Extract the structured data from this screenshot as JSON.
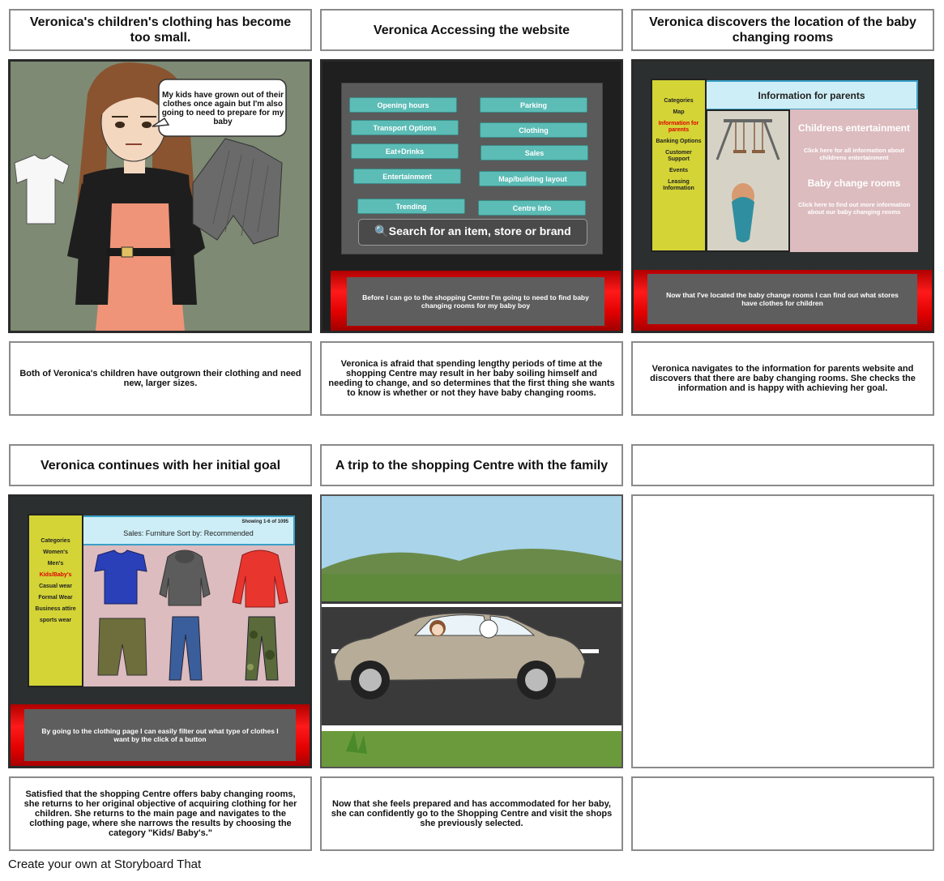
{
  "cells": [
    {
      "title": "Veronica's children's clothing has become too small.",
      "description": "Both of Veronica's children have outgrown their clothing and need new, larger sizes.",
      "speech": "My kids have grown out of their clothes once again but I'm also going to need to prepare for my baby"
    },
    {
      "title": "Veronica Accessing the website",
      "description": "Veronica is afraid that spending lengthy periods of time at the shopping Centre may result in her baby soiling himself and needing to change, and so determines that the first thing she wants to know is whether or not they have baby changing rooms.",
      "menu_left": [
        "Opening hours",
        "Transport Options",
        "Eat+Drinks",
        "Entertainment",
        "Trending"
      ],
      "menu_right": [
        "Parking",
        "Clothing",
        "Sales",
        "Map/building layout",
        "Centre Info"
      ],
      "search_label": "Search for an item, store or brand",
      "caption": "Before I can go to the shopping Centre I'm going to need to find baby changing rooms for my baby boy"
    },
    {
      "title": "Veronica discovers the location of the baby changing rooms",
      "description": "Veronica navigates to the information for parents website and discovers that there are baby changing rooms. She checks the information and is happy with achieving her goal.",
      "header": "Information for parents",
      "sidebar": [
        "Categories",
        "Map",
        "Information for parents",
        "Banking Options",
        "Customer Support",
        "Events",
        "Leasing Information"
      ],
      "entertainment_title": "Childrens entertainment",
      "entertainment_text": "Click here for all information about childrens entertainment",
      "baby_title": "Baby change rooms",
      "baby_text": "Click here to find out more information about our baby changing rooms",
      "caption": "Now that I've located the baby change rooms I can find out what stores have clothes for children"
    },
    {
      "title": "Veronica continues with her initial goal",
      "description": "Satisfied that the shopping Centre offers baby changing rooms, she returns to her original objective of acquiring clothing for her children. She returns to the main page and navigates to the clothing page, where she narrows the results by choosing the category \"Kids/ Baby's.\"",
      "header": "Sales: Furniture Sort by: Recommended",
      "showing": "Showing 1-6 of 1095",
      "sidebar": [
        "Categories",
        "Women's",
        "Men's",
        "Kids/Baby's",
        "Casual wear",
        "Formal Wear",
        "Business attire",
        "sports wear"
      ],
      "caption": "By going to the clothing page I can easily filter out what type of clothes I want by the click of a button"
    },
    {
      "title": "A trip to the shopping Centre with the family",
      "description": "Now that she feels prepared and has accommodated for her baby, she can confidently go to the Shopping Centre and visit the shops she previously selected."
    },
    {
      "title": "",
      "description": ""
    }
  ],
  "footer": "Create your own at Storyboard That",
  "colors": {
    "teal": "#5cbcb6",
    "yellow": "#d4d436",
    "red": "#e00000",
    "light_blue": "#cdeef6",
    "pink": "#dcbcbf"
  }
}
